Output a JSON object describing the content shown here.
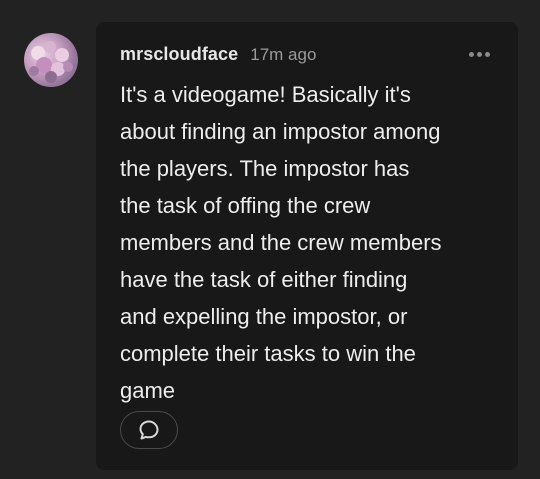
{
  "comment": {
    "username": "mrscloudface",
    "timestamp": "17m ago",
    "text": "It's a videogame! Basically it's\nabout finding an impostor among\nthe players. The impostor has\nthe task of offing the crew\nmembers and the crew members\nhave the task of either finding\nand expelling the impostor, or\ncomplete their tasks to win the\ngame"
  },
  "icons": {
    "more": "more-options-icon",
    "reply": "speech-bubble-icon"
  },
  "colors": {
    "background": "#222222",
    "card": "#181818",
    "text": "#ededed",
    "muted": "#9a9a9a"
  }
}
